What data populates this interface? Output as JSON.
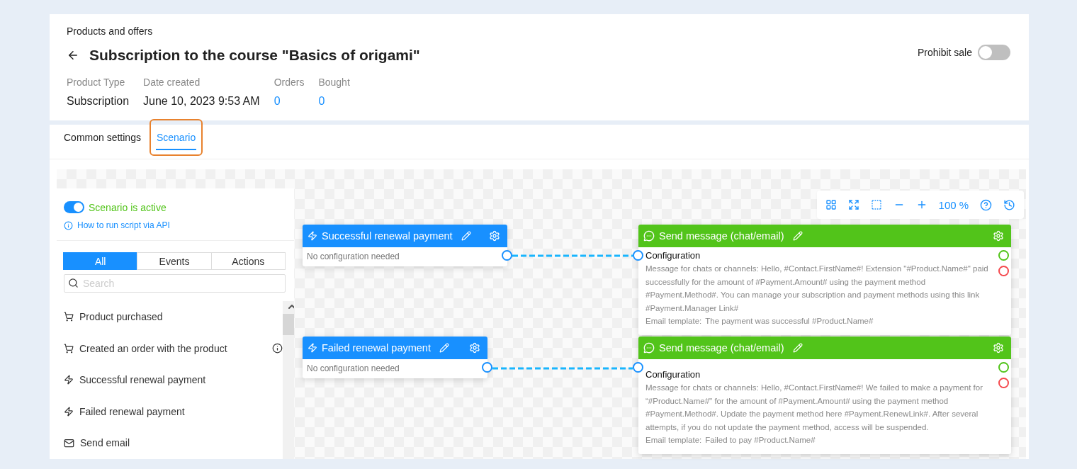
{
  "breadcrumb": "Products and offers",
  "title": "Subscription to the course \"Basics of origami\"",
  "prohibit_sale": {
    "label": "Prohibit sale",
    "on": false
  },
  "meta": [
    {
      "label": "Product Type",
      "value": "Subscription",
      "kind": "text"
    },
    {
      "label": "Date created",
      "value": "June 10, 2023 9:53 AM",
      "kind": "text"
    },
    {
      "label": "Orders",
      "value": "0",
      "kind": "link"
    },
    {
      "label": "Bought",
      "value": "0",
      "kind": "link"
    }
  ],
  "tabs": [
    {
      "label": "Common settings",
      "selected": false
    },
    {
      "label": "Scenario",
      "selected": true
    }
  ],
  "scenario": {
    "active": true,
    "label": "Scenario is active",
    "api_link": "How to run script via API"
  },
  "filter_tabs": [
    {
      "label": "All",
      "selected": true
    },
    {
      "label": "Events",
      "selected": false
    },
    {
      "label": "Actions",
      "selected": false
    }
  ],
  "search": {
    "placeholder": "Search"
  },
  "palette": [
    {
      "label": "Product purchased",
      "kind": "cart",
      "info": false
    },
    {
      "label": "Created an order with the product",
      "kind": "cart",
      "info": true
    },
    {
      "label": "Successful renewal payment",
      "kind": "event",
      "info": false
    },
    {
      "label": "Failed renewal payment",
      "kind": "event",
      "info": false
    },
    {
      "label": "Send email",
      "kind": "mail",
      "info": false
    }
  ],
  "toolbar": {
    "zoom": "100 %"
  },
  "triggers": [
    {
      "title": "Successful renewal payment",
      "note": "No configuration needed"
    },
    {
      "title": "Failed renewal payment",
      "note": "No configuration needed"
    }
  ],
  "actions": [
    {
      "title": "Send message (chat/email)",
      "config_label": "Configuration",
      "message": "Message for chats or channels: Hello, #Contact.FirstName#! Extension \"#Product.Name#\" paid successfully for the amount of #Payment.Amount# using the payment method #Payment.Method#. You can manage your subscription and payment methods using this link #Payment.Manager Link#",
      "email_label": "Email template:",
      "email_value": "The payment was successful #Product.Name#"
    },
    {
      "title": "Send message (chat/email)",
      "config_label": "Configuration",
      "message": "Message for chats or channels: Hello, #Contact.FirstName#! We failed to make a payment for “#Product.Name#\" for the amount of #Payment.Amount# using the payment method #Payment.Method#. Update the payment method here #Payment.RenewLink#. After several attempts, if you do not update the payment method, access will be suspended.",
      "email_label": "Email template:",
      "email_value": "Failed to pay #Product.Name#"
    }
  ]
}
